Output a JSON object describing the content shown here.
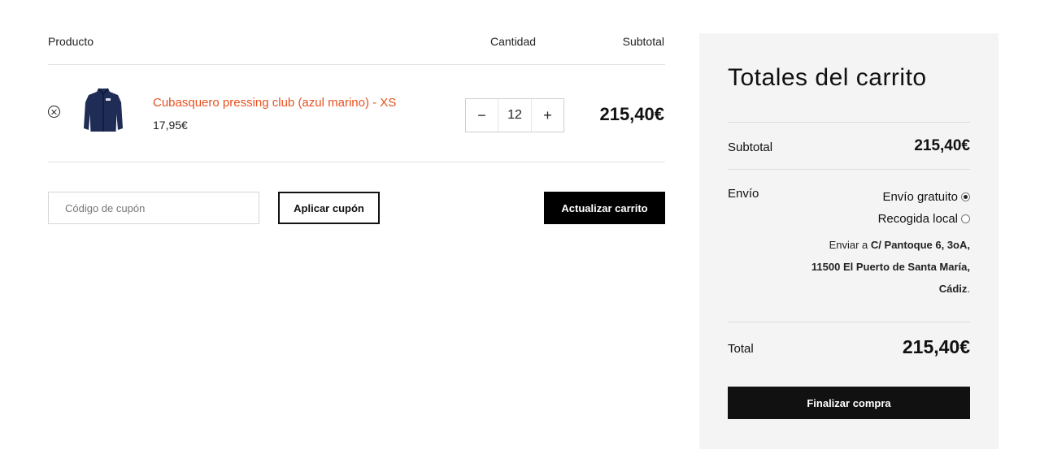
{
  "cart": {
    "headers": {
      "product": "Producto",
      "quantity": "Cantidad",
      "subtotal": "Subtotal"
    },
    "items": [
      {
        "name": "Cubasquero pressing club (azul marino) - XS",
        "unit_price": "17,95€",
        "quantity": "12",
        "subtotal": "215,40€",
        "thumb_icon": "navy-jacket-icon",
        "remove_icon": "remove-circle-x-icon"
      }
    ],
    "coupon": {
      "placeholder": "Código de cupón",
      "value": ""
    },
    "apply_label": "Aplicar cupón",
    "update_label": "Actualizar carrito",
    "qty_minus": "−",
    "qty_plus": "+"
  },
  "totals": {
    "title": "Totales del carrito",
    "subtotal_label": "Subtotal",
    "subtotal_value": "215,40€",
    "shipping_label": "Envío",
    "shipping_options": [
      {
        "label": "Envío gratuito",
        "selected": true
      },
      {
        "label": "Recogida local",
        "selected": false
      }
    ],
    "ship_to_prefix": "Enviar a",
    "ship_to_address": "C/ Pantoque 6, 3oA, 11500 El Puerto de Santa María, Cádiz",
    "ship_to_suffix": ".",
    "total_label": "Total",
    "total_value": "215,40€",
    "checkout_label": "Finalizar compra"
  },
  "colors": {
    "accent": "#e8501f",
    "panel_bg": "#f4f4f4",
    "button_dark": "#111111"
  }
}
